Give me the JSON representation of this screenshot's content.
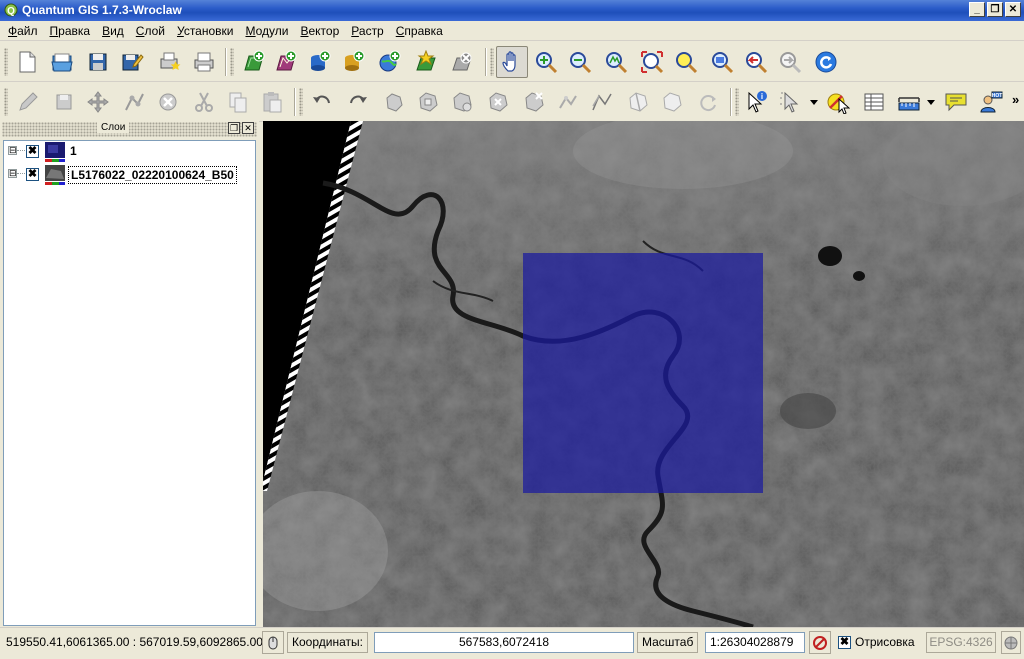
{
  "window": {
    "title": "Quantum GIS 1.7.3-Wroclaw"
  },
  "menu": {
    "items": [
      {
        "label": "Файл",
        "hotkey_index": 0
      },
      {
        "label": "Правка",
        "hotkey_index": 0
      },
      {
        "label": "Вид",
        "hotkey_index": 0
      },
      {
        "label": "Слой",
        "hotkey_index": 0
      },
      {
        "label": "Установки",
        "hotkey_index": 0
      },
      {
        "label": "Модули",
        "hotkey_index": 0
      },
      {
        "label": "Вектор",
        "hotkey_index": 0
      },
      {
        "label": "Растр",
        "hotkey_index": 0
      },
      {
        "label": "Справка",
        "hotkey_index": 0
      }
    ]
  },
  "toolbar1": {
    "buttons": [
      "new-project-icon",
      "open-project-icon",
      "save-project-icon",
      "save-as-icon",
      "new-print-composer-icon",
      "print-icon",
      "add-raster-icon",
      "add-vector-icon",
      "add-postgis-icon",
      "add-spatialite-icon",
      "add-wms-icon",
      "new-layer-icon",
      "remove-layer-icon",
      "pan-icon",
      "zoom-in-icon",
      "zoom-out-icon",
      "zoom-full-icon",
      "zoom-to-selection-icon",
      "zoom-to-layer-icon",
      "zoom-actual-icon",
      "zoom-last-icon",
      "zoom-next-icon",
      "refresh-icon"
    ]
  },
  "toolbar2": {
    "overflow": "»"
  },
  "layers_panel": {
    "title": "Слои",
    "layers": [
      {
        "name": "1",
        "checked": "✖",
        "expander": "⊟",
        "thumb_color": "#2a2a8a"
      },
      {
        "name": "L5176022_02220100624_B50",
        "checked": "✖",
        "expander": "⊟",
        "thumb_color": "#555555"
      }
    ]
  },
  "status": {
    "extent": "519550.41,6061365.00 : 567019.59,6092865.00",
    "coord_label": "Координаты:",
    "coord_value": "567583,6072418",
    "scale_label": "Масштаб",
    "scale_value": "1:26304028879",
    "render_label": "Отрисовка",
    "render_checked": "✖",
    "crs": "EPSG:4326"
  },
  "colors": {
    "title_bar": "#2a5bc8",
    "selection_overlay": "#1a1aa0"
  }
}
